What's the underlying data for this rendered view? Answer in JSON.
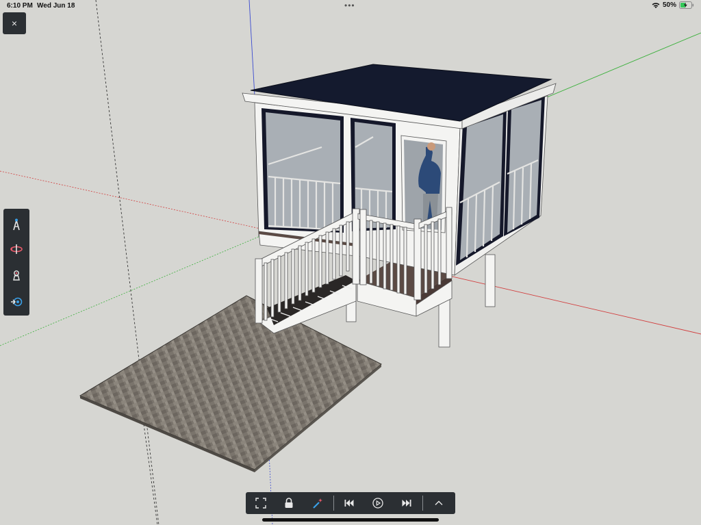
{
  "status_bar": {
    "time": "6:10 PM",
    "date": "Wed Jun 18",
    "multitask": "•••",
    "battery_percent": "50%",
    "battery_level": 0.5
  },
  "close_button": {
    "label": "×"
  },
  "side_toolbar": {
    "items": [
      {
        "name": "select-tool",
        "icon": "arrow-select-icon"
      },
      {
        "name": "orbit-tool",
        "icon": "orbit-icon"
      },
      {
        "name": "walk-tool",
        "icon": "walk-icon"
      },
      {
        "name": "look-around-tool",
        "icon": "look-around-icon"
      }
    ]
  },
  "bottom_toolbar": {
    "items": [
      {
        "name": "zoom-extents",
        "icon": "zoom-extents-icon"
      },
      {
        "name": "lock",
        "icon": "lock-icon"
      },
      {
        "name": "magic-wand",
        "icon": "magic-wand-icon"
      },
      {
        "name": "previous-scene",
        "icon": "skip-back-icon"
      },
      {
        "name": "play",
        "icon": "play-icon"
      },
      {
        "name": "next-scene",
        "icon": "skip-forward-icon"
      },
      {
        "name": "expand",
        "icon": "chevron-up-icon"
      }
    ]
  },
  "colors": {
    "canvas": "#d6d6d2",
    "toolbar": "#2b2f33",
    "axis_red": "#d23c3c",
    "axis_green": "#3ab03a",
    "axis_blue": "#3a4ad0",
    "roof": "#141a2e",
    "trim": "#f4f4f2",
    "paver": "#7a746c"
  }
}
